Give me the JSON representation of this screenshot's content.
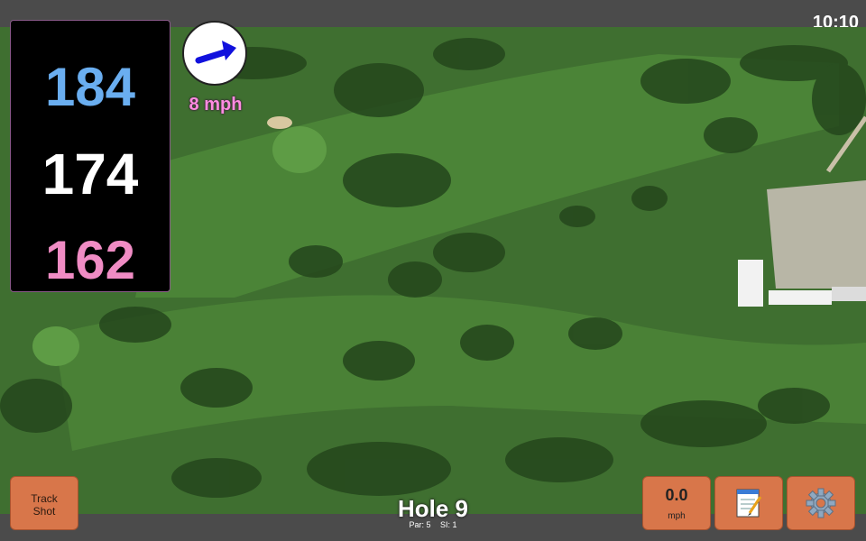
{
  "status": {
    "time": "10:10"
  },
  "distances": {
    "back": "184",
    "middle": "174",
    "front": "162"
  },
  "wind": {
    "speed": "8 mph",
    "arrow_icon": "wind-arrow-icon"
  },
  "hole": {
    "title": "Hole 9",
    "par": "Par: 5",
    "si": "SI: 1"
  },
  "buttons": {
    "track_shot_line1": "Track",
    "track_shot_line2": "Shot",
    "speed_value": "0.0",
    "speed_unit": "mph",
    "notes_icon": "notepad-icon",
    "settings_icon": "gear-icon"
  },
  "colors": {
    "back": "#6aaef0",
    "middle": "#ffffff",
    "front": "#f08cc4",
    "wind_text": "#ff8ce0",
    "button": "#d8764a"
  }
}
